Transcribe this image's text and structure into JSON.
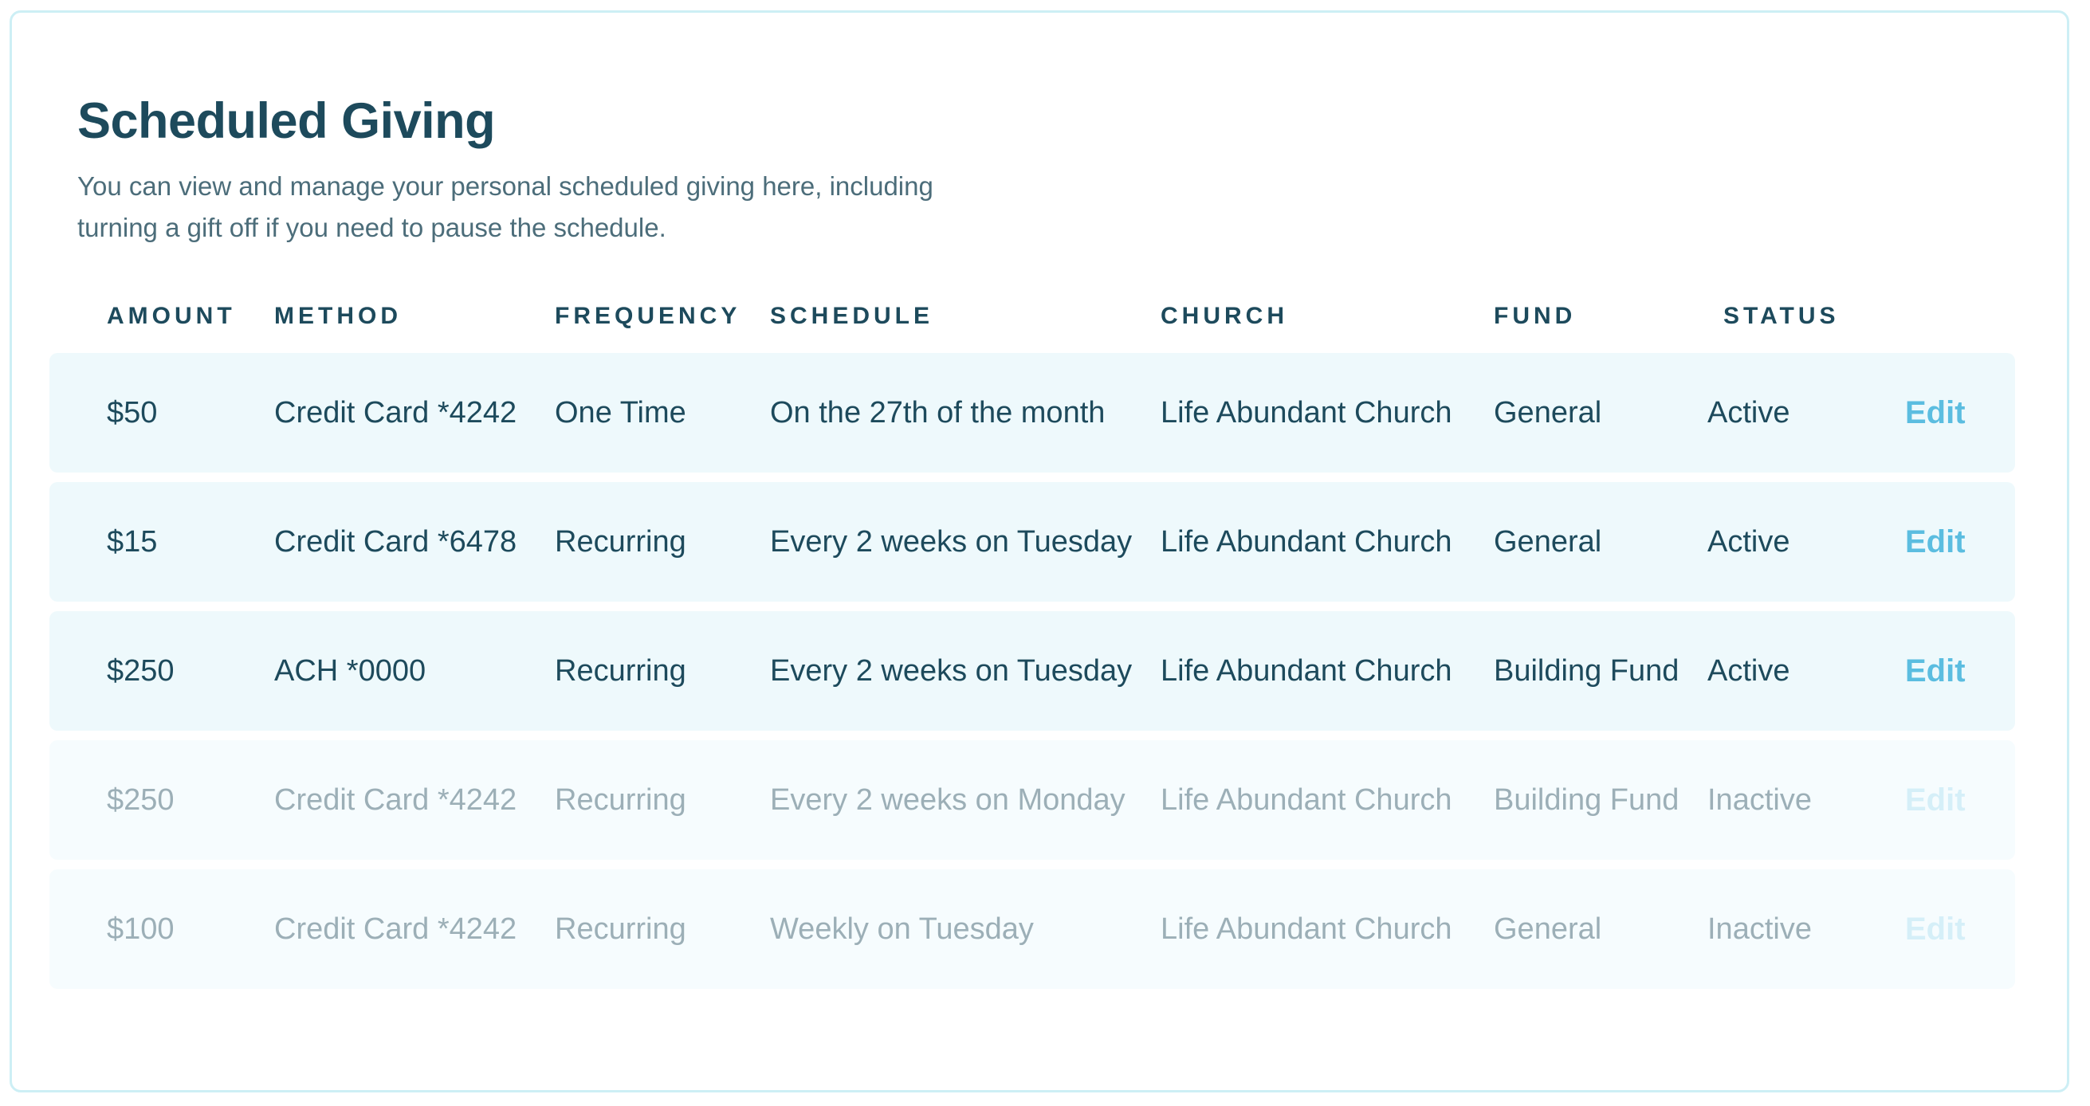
{
  "page": {
    "title": "Scheduled Giving",
    "description": "You can view and manage your personal scheduled giving here, including turning a gift off if you need to pause the schedule."
  },
  "table": {
    "headers": {
      "amount": "AMOUNT",
      "method": "METHOD",
      "frequency": "FREQUENCY",
      "schedule": "SCHEDULE",
      "church": "CHURCH",
      "fund": "FUND",
      "status": "STATUS"
    },
    "edit_label": "Edit",
    "rows": [
      {
        "amount": "$50",
        "method": "Credit Card *4242",
        "frequency": "One Time",
        "schedule": "On the 27th of the month",
        "church": "Life Abundant Church",
        "fund": "General",
        "status": "Active"
      },
      {
        "amount": "$15",
        "method": "Credit Card *6478",
        "frequency": "Recurring",
        "schedule": "Every 2 weeks on Tuesday",
        "church": "Life Abundant Church",
        "fund": "General",
        "status": "Active"
      },
      {
        "amount": "$250",
        "method": "ACH *0000",
        "frequency": "Recurring",
        "schedule": "Every 2 weeks on Tuesday",
        "church": "Life Abundant Church",
        "fund": "Building Fund",
        "status": "Active"
      },
      {
        "amount": "$250",
        "method": "Credit Card *4242",
        "frequency": "Recurring",
        "schedule": "Every 2 weeks on Monday",
        "church": "Life Abundant Church",
        "fund": "Building Fund",
        "status": "Inactive"
      },
      {
        "amount": "$100",
        "method": "Credit Card *4242",
        "frequency": "Recurring",
        "schedule": "Weekly on Tuesday",
        "church": "Life Abundant Church",
        "fund": "General",
        "status": "Inactive"
      }
    ]
  },
  "colors": {
    "heading": "#1d4a5c",
    "body_text": "#4c6d7a",
    "inactive_text": "#9cafb7",
    "edit_link": "#5bbde0",
    "edit_link_disabled": "#d5eff8",
    "row_background": "#eef9fc",
    "card_border": "#cdeff5"
  }
}
